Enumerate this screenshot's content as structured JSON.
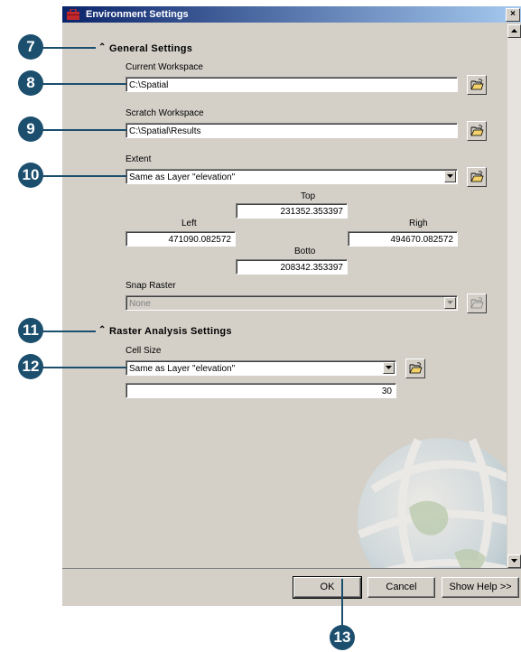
{
  "window": {
    "title": "Environment Settings",
    "close_glyph": "×"
  },
  "general": {
    "header": "General Settings",
    "current_workspace": {
      "label": "Current Workspace",
      "value": "C:\\Spatial"
    },
    "scratch_workspace": {
      "label": "Scratch Workspace",
      "value": "C:\\Spatial\\Results"
    },
    "extent": {
      "label": "Extent",
      "value": "Same as Layer \"elevation\"",
      "top_label": "Top",
      "top_value": "231352.353397",
      "left_label": "Left",
      "left_value": "471090.082572",
      "right_label": "Righ",
      "right_value": "494670.082572",
      "bottom_label": "Botto",
      "bottom_value": "208342.353397"
    },
    "snap_raster": {
      "label": "Snap Raster",
      "value": "None"
    }
  },
  "raster": {
    "header": "Raster Analysis Settings",
    "cell_size": {
      "label": "Cell Size",
      "value": "Same as Layer \"elevation\"",
      "number": "30"
    }
  },
  "buttons": {
    "ok": "OK",
    "cancel": "Cancel",
    "help": "Show Help >>"
  },
  "callouts": [
    "7",
    "8",
    "9",
    "10",
    "11",
    "12",
    "13"
  ],
  "colors": {
    "callout": "#1c4e6e",
    "titlebar_start": "#0a246a",
    "titlebar_end": "#a6caf0",
    "dialog_bg": "#d4d0c8"
  }
}
